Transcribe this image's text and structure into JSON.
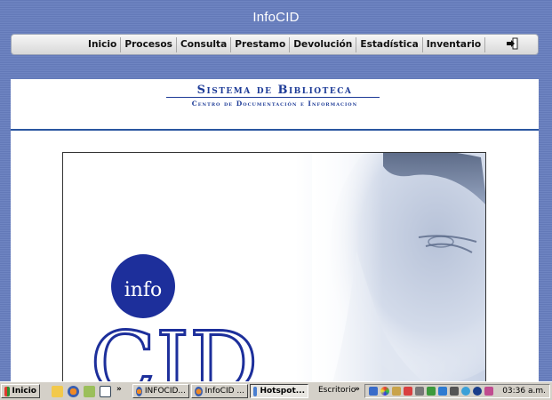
{
  "app": {
    "title": "InfoCID"
  },
  "menu": {
    "items": [
      "Inicio",
      "Procesos",
      "Consulta",
      "Prestamo",
      "Devolución",
      "Estadística",
      "Inventario"
    ]
  },
  "header": {
    "title": "Sistema de Biblioteca",
    "subtitle": "Centro de Documentación e Informacion"
  },
  "banner": {
    "logo_top": "info",
    "logo_bottom": "CID"
  },
  "taskbar": {
    "start_label": "Inicio",
    "windows": [
      "INFOCID...",
      "InfoCID ...",
      "Hotspot..."
    ],
    "desktop_label": "Escritorio",
    "clock": "03:36 a.m."
  },
  "colors": {
    "background": "#6d83c0",
    "accent": "#1d3b97",
    "rule": "#2a56a0"
  }
}
